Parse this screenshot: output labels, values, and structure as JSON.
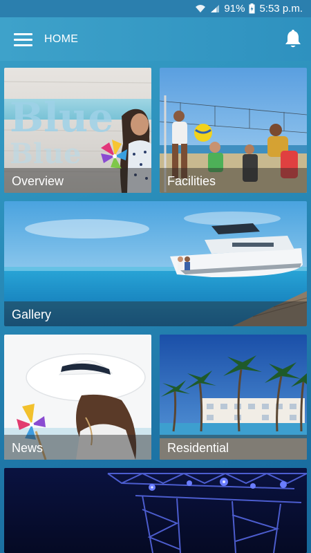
{
  "status_bar": {
    "battery": "91%",
    "time": "5:53 p.m."
  },
  "app_bar": {
    "title": "HOME",
    "menu_icon": "hamburger-menu-icon",
    "notification_icon": "bell-icon"
  },
  "tiles": [
    {
      "label": "Overview"
    },
    {
      "label": "Facilities"
    },
    {
      "label": "Gallery"
    },
    {
      "label": "News"
    },
    {
      "label": "Residential"
    },
    {
      "label": ""
    }
  ],
  "overview_sign_text": "Blue",
  "colors": {
    "primary": "#2e91bf",
    "status_bar": "#2b7fae",
    "caption_overlay": "rgba(40,40,40,0.45)"
  }
}
